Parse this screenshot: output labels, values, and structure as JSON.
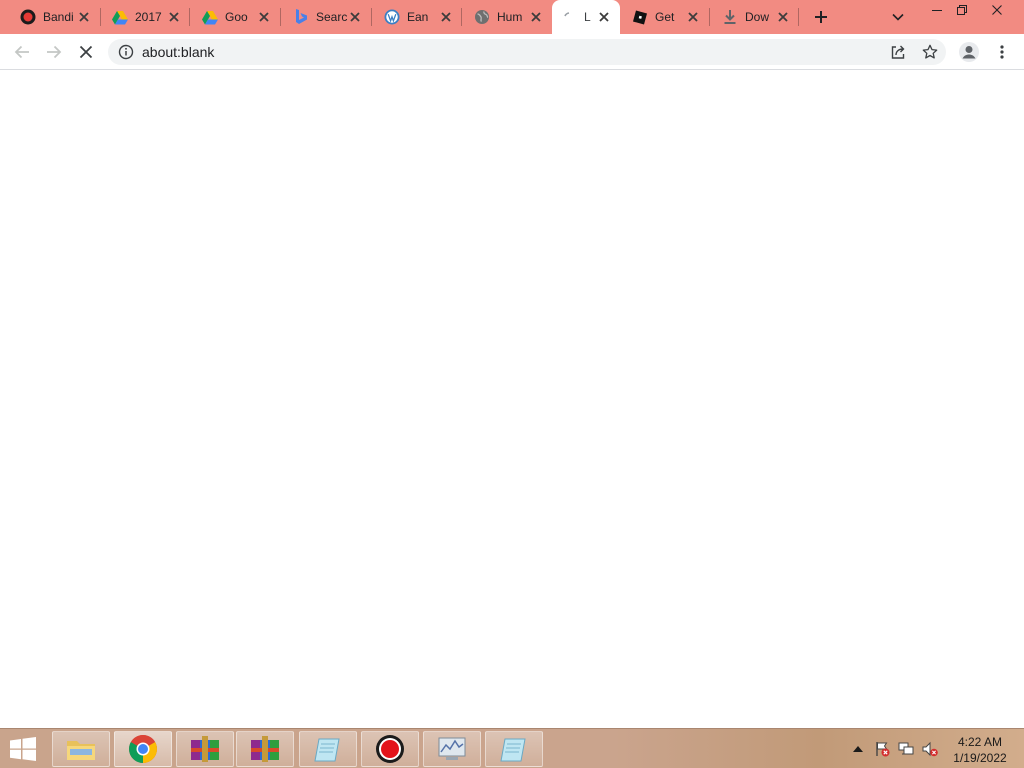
{
  "browser": {
    "tabs": [
      {
        "title": "Bandi",
        "favicon": "record-icon",
        "active": false
      },
      {
        "title": "2017",
        "favicon": "google-drive-icon",
        "active": false
      },
      {
        "title": "Goo",
        "favicon": "google-drive-icon",
        "active": false
      },
      {
        "title": "Searc",
        "favicon": "bing-search-icon",
        "active": false
      },
      {
        "title": "Ean",
        "favicon": "wordpress-icon",
        "active": false
      },
      {
        "title": "Hum",
        "favicon": "globe-icon",
        "active": false
      },
      {
        "title": "L",
        "favicon": "loading-icon",
        "active": true
      },
      {
        "title": "Get",
        "favicon": "roblox-icon",
        "active": false
      },
      {
        "title": "Dow",
        "favicon": "download-icon",
        "active": false
      }
    ],
    "new_tab_label": "+",
    "address": {
      "url": "about:blank"
    },
    "colors": {
      "tab_strip": "#f28b82",
      "omnibox": "#f1f3f4"
    }
  },
  "taskbar": {
    "apps": [
      {
        "name": "file-explorer",
        "icon": "folder-icon"
      },
      {
        "name": "chrome",
        "icon": "chrome-icon",
        "active": true
      },
      {
        "name": "winrar-1",
        "icon": "winrar-icon"
      },
      {
        "name": "winrar-2",
        "icon": "winrar-icon"
      },
      {
        "name": "notepad-1",
        "icon": "notepad-icon"
      },
      {
        "name": "bandicam",
        "icon": "record-icon"
      },
      {
        "name": "resource-monitor",
        "icon": "monitor-icon"
      },
      {
        "name": "notepad-2",
        "icon": "notepad-icon"
      }
    ],
    "clock": {
      "time": "4:22 AM",
      "date": "1/19/2022"
    }
  }
}
